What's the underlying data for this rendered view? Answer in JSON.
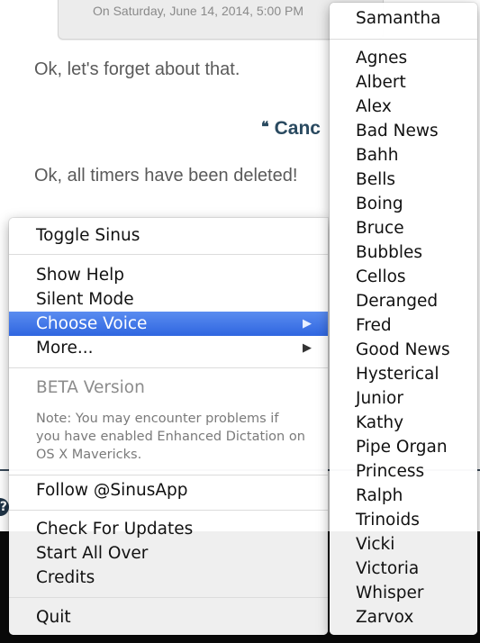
{
  "background_app": {
    "timestamp": "On Saturday, June 14, 2014, 5:00 PM",
    "messages": [
      "Ok, let's forget about that.",
      "Ok, all timers have been deleted!"
    ],
    "command_quote_icon": "❝",
    "command_text": "Canc",
    "help_icon": "?"
  },
  "main_menu": {
    "items": [
      {
        "label": "Toggle Sinus"
      },
      {
        "label": "Show Help"
      },
      {
        "label": "Silent Mode"
      },
      {
        "label": "Choose Voice",
        "submenu": true,
        "highlighted": true
      },
      {
        "label": "More...",
        "submenu": true
      },
      {
        "label": "BETA Version",
        "disabled": true
      },
      {
        "label": "Follow @SinusApp"
      },
      {
        "label": "Check For Updates"
      },
      {
        "label": "Start All Over"
      },
      {
        "label": "Credits"
      },
      {
        "label": "Quit"
      }
    ],
    "note": "Note: You may encounter problems if you have enabled Enhanced Dictation on OS X Mavericks.",
    "submenu_arrow": "▶"
  },
  "voice_menu": {
    "current": "Samantha",
    "voices": [
      "Agnes",
      "Albert",
      "Alex",
      "Bad News",
      "Bahh",
      "Bells",
      "Boing",
      "Bruce",
      "Bubbles",
      "Cellos",
      "Deranged",
      "Fred",
      "Good News",
      "Hysterical",
      "Junior",
      "Kathy",
      "Pipe Organ",
      "Princess",
      "Ralph",
      "Trinoids",
      "Vicki",
      "Victoria",
      "Whisper",
      "Zarvox"
    ]
  },
  "colors": {
    "highlight": "#2f66e0",
    "command_link": "#2a4a60"
  }
}
